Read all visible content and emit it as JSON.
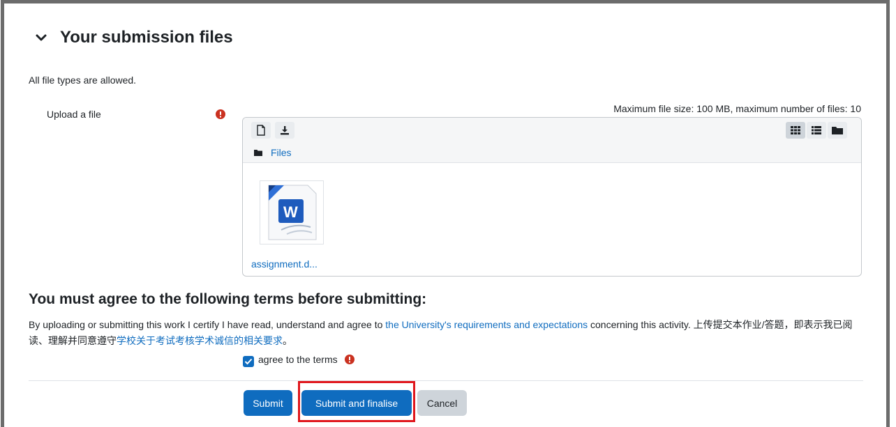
{
  "section": {
    "title": "Your submission files",
    "toggle_icon": "chevron-down-icon"
  },
  "filetypes_note": "All file types are allowed.",
  "upload": {
    "label": "Upload a file",
    "required_icon": "exclamation-circle-icon",
    "limits": "Maximum file size: 100 MB, maximum number of files: 10",
    "toolbar": {
      "left_icons": [
        "add-file-icon",
        "download-icon"
      ],
      "view_icons": [
        "grid-view-icon",
        "list-view-icon",
        "tree-view-icon"
      ],
      "active_view": "grid-view-icon"
    },
    "breadcrumb": "Files",
    "files": [
      {
        "name": "assignment.d...",
        "icon": "word-document-icon"
      }
    ]
  },
  "terms": {
    "title": "You must agree to the following terms before submitting:",
    "text_before": "By uploading or submitting this work I certify I have read, understand and agree to ",
    "link1": "the University's requirements and expectations",
    "text_middle": " concerning this activity. 上传提交本作业/答题，即表示我已阅读、理解并同意遵守",
    "link2": "学校关于考试考核学术诚信的相关要求",
    "text_after": "。",
    "checkbox_label": "agree to the terms",
    "checkbox_checked": true
  },
  "buttons": {
    "submit": "Submit",
    "submit_finalise": "Submit and finalise",
    "cancel": "Cancel"
  },
  "colors": {
    "primary": "#0f6cbf",
    "danger": "#ca3120",
    "highlight": "#e0161c"
  }
}
